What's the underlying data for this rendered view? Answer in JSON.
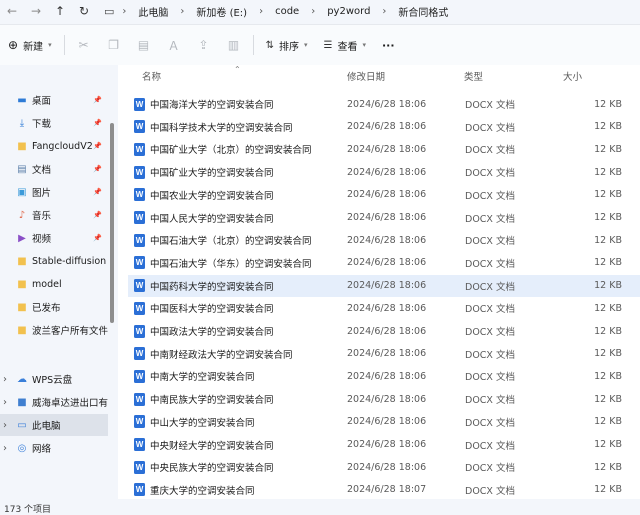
{
  "nav": {
    "back": "←",
    "forward": "→",
    "up": "↑",
    "refresh": "↻"
  },
  "breadcrumb": [
    "此电脑",
    "新加卷 (E:)",
    "code",
    "py2word",
    "新合同格式"
  ],
  "toolbar": {
    "new_label": "新建",
    "sort_label": "排序",
    "view_label": "查看",
    "more_label": "···"
  },
  "sidebar": {
    "items": [
      {
        "label": "桌面",
        "icon": "desktop-icon",
        "glyph": "▬",
        "color": "#2e7bd6",
        "pinned": true
      },
      {
        "label": "下载",
        "icon": "download-icon",
        "glyph": "⤓",
        "color": "#2e7bd6",
        "pinned": true
      },
      {
        "label": "FangcloudV2",
        "icon": "folder-icon",
        "glyph": "■",
        "color": "#f2c14e",
        "pinned": true
      },
      {
        "label": "文档",
        "icon": "documents-icon",
        "glyph": "▤",
        "color": "#5b7fa8",
        "pinned": true
      },
      {
        "label": "图片",
        "icon": "pictures-icon",
        "glyph": "▣",
        "color": "#3b9ad9",
        "pinned": true
      },
      {
        "label": "音乐",
        "icon": "music-icon",
        "glyph": "♪",
        "color": "#e0694a",
        "pinned": true
      },
      {
        "label": "视频",
        "icon": "videos-icon",
        "glyph": "▶",
        "color": "#8a4fc7",
        "pinned": true
      },
      {
        "label": "Stable-diffusion",
        "icon": "folder-icon",
        "glyph": "■",
        "color": "#f2c14e",
        "pinned": false
      },
      {
        "label": "model",
        "icon": "folder-icon",
        "glyph": "■",
        "color": "#f2c14e",
        "pinned": false
      },
      {
        "label": "已发布",
        "icon": "folder-icon",
        "glyph": "■",
        "color": "#f2c14e",
        "pinned": false
      },
      {
        "label": "波兰客户所有文件",
        "icon": "folder-icon",
        "glyph": "■",
        "color": "#f2c14e",
        "pinned": false
      }
    ],
    "roots": [
      {
        "label": "WPS云盘",
        "icon": "cloud-icon",
        "glyph": "☁",
        "color": "#3a7fd9"
      },
      {
        "label": "威海卓达进出口有限公司",
        "icon": "folder-icon",
        "glyph": "■",
        "color": "#3f7fd0"
      },
      {
        "label": "此电脑",
        "icon": "computer-icon",
        "glyph": "▭",
        "color": "#3a7fd9"
      },
      {
        "label": "网络",
        "icon": "network-icon",
        "glyph": "◎",
        "color": "#3a7fd9"
      }
    ]
  },
  "columns": {
    "name": "名称",
    "date": "修改日期",
    "type": "类型",
    "size": "大小"
  },
  "files": [
    {
      "name": "中国海洋大学的空调安装合同",
      "date": "2024/6/28 18:06",
      "type": "DOCX 文档",
      "size": "12 KB"
    },
    {
      "name": "中国科学技术大学的空调安装合同",
      "date": "2024/6/28 18:06",
      "type": "DOCX 文档",
      "size": "12 KB"
    },
    {
      "name": "中国矿业大学（北京）的空调安装合同",
      "date": "2024/6/28 18:06",
      "type": "DOCX 文档",
      "size": "12 KB"
    },
    {
      "name": "中国矿业大学的空调安装合同",
      "date": "2024/6/28 18:06",
      "type": "DOCX 文档",
      "size": "12 KB"
    },
    {
      "name": "中国农业大学的空调安装合同",
      "date": "2024/6/28 18:06",
      "type": "DOCX 文档",
      "size": "12 KB"
    },
    {
      "name": "中国人民大学的空调安装合同",
      "date": "2024/6/28 18:06",
      "type": "DOCX 文档",
      "size": "12 KB"
    },
    {
      "name": "中国石油大学（北京）的空调安装合同",
      "date": "2024/6/28 18:06",
      "type": "DOCX 文档",
      "size": "12 KB"
    },
    {
      "name": "中国石油大学（华东）的空调安装合同",
      "date": "2024/6/28 18:06",
      "type": "DOCX 文档",
      "size": "12 KB"
    },
    {
      "name": "中国药科大学的空调安装合同",
      "date": "2024/6/28 18:06",
      "type": "DOCX 文档",
      "size": "12 KB"
    },
    {
      "name": "中国医科大学的空调安装合同",
      "date": "2024/6/28 18:06",
      "type": "DOCX 文档",
      "size": "12 KB"
    },
    {
      "name": "中国政法大学的空调安装合同",
      "date": "2024/6/28 18:06",
      "type": "DOCX 文档",
      "size": "12 KB"
    },
    {
      "name": "中南财经政法大学的空调安装合同",
      "date": "2024/6/28 18:06",
      "type": "DOCX 文档",
      "size": "12 KB"
    },
    {
      "name": "中南大学的空调安装合同",
      "date": "2024/6/28 18:06",
      "type": "DOCX 文档",
      "size": "12 KB"
    },
    {
      "name": "中南民族大学的空调安装合同",
      "date": "2024/6/28 18:06",
      "type": "DOCX 文档",
      "size": "12 KB"
    },
    {
      "name": "中山大学的空调安装合同",
      "date": "2024/6/28 18:06",
      "type": "DOCX 文档",
      "size": "12 KB"
    },
    {
      "name": "中央财经大学的空调安装合同",
      "date": "2024/6/28 18:06",
      "type": "DOCX 文档",
      "size": "12 KB"
    },
    {
      "name": "中央民族大学的空调安装合同",
      "date": "2024/6/28 18:06",
      "type": "DOCX 文档",
      "size": "12 KB"
    },
    {
      "name": "重庆大学的空调安装合同",
      "date": "2024/6/28 18:07",
      "type": "DOCX 文档",
      "size": "12 KB"
    }
  ],
  "status": {
    "item_count": "173 个项目"
  }
}
